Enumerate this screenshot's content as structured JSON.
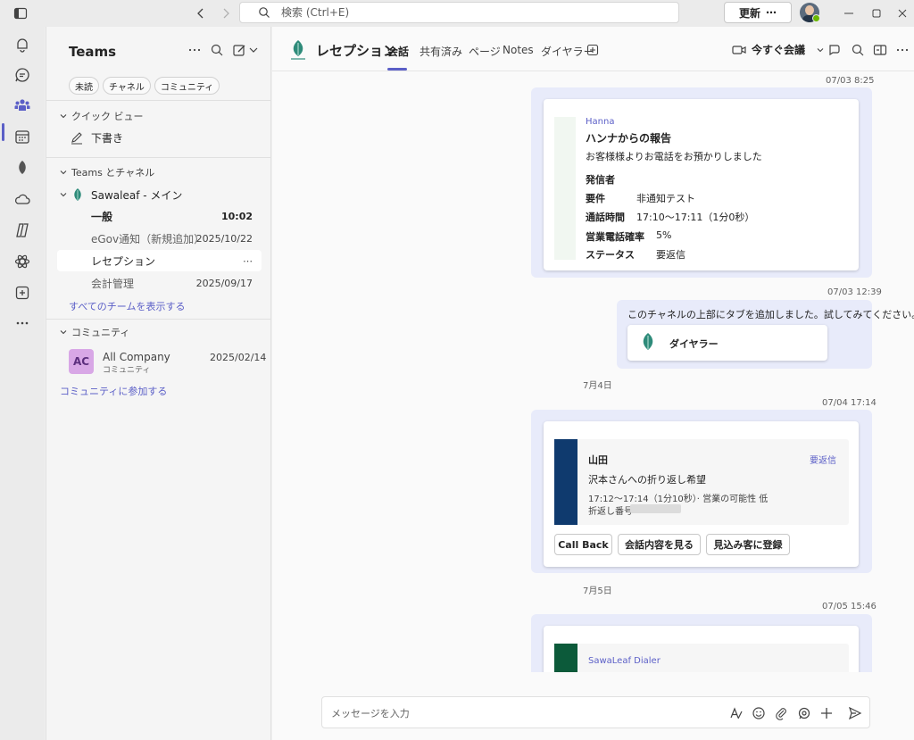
{
  "titlebar": {
    "search_placeholder": "検索 (Ctrl+E)",
    "update_label": "更新",
    "update_more": "⋯"
  },
  "pane": {
    "title": "Teams",
    "filters": [
      "未読",
      "チャネル",
      "コミュニティ"
    ],
    "quick_view": {
      "header": "クイック ビュー",
      "drafts": "下書き"
    },
    "teams_section": {
      "header": "Teams とチャネル"
    },
    "team": {
      "name": "Sawaleaf - メイン"
    },
    "channels": [
      {
        "name": "一般",
        "time": "10:02"
      },
      {
        "name": "eGov通知（新規追加）",
        "time": "2025/10/22"
      },
      {
        "name": "レセプション",
        "time": "⋯"
      },
      {
        "name": "会計管理",
        "time": "2025/09/17"
      }
    ],
    "show_all": "すべてのチームを表示する",
    "community_section": {
      "header": "コミュニティ"
    },
    "community": {
      "initials": "AC",
      "name": "All Company",
      "sub": "コミュニティ",
      "time": "2025/02/14"
    },
    "join_community": "コミュニティに参加する"
  },
  "header": {
    "channel_name": "レセプション",
    "tabs": [
      "会話",
      "共有済み",
      "ページ",
      "Notes",
      "ダイヤラー"
    ],
    "meet_now": "今すぐ会議"
  },
  "messages": {
    "m1": {
      "timestamp": "07/03 8:25",
      "sender": "Hanna",
      "title": "ハンナからの報告",
      "body": "お客様様よりお電話をお預かりしました",
      "caller_label": "発信者",
      "fields": [
        {
          "label": "要件",
          "value": "非通知テスト"
        },
        {
          "label": "通話時間",
          "value": "17:10〜17:11（1分0秒）"
        },
        {
          "label": "営業電話確率",
          "value": "5%"
        },
        {
          "label": "ステータス",
          "value": "要返信"
        }
      ]
    },
    "m2": {
      "timestamp": "07/03 12:39",
      "text": "このチャネルの上部にタブを追加しました。試してみてください。",
      "tab_name": "ダイヤラー"
    },
    "day1": "7月4日",
    "m3": {
      "timestamp": "07/04 17:14",
      "name": "山田",
      "status": "要返信",
      "subject": "沢本さんへの折り返し希望",
      "detail": "17:12〜17:14（1分10秒）· 営業の可能性 低",
      "callback_label": "折返し番号",
      "buttons": [
        "Call Back",
        "会話内容を見る",
        "見込み客に登録"
      ]
    },
    "day2": "7月5日",
    "m4": {
      "timestamp": "07/05 15:46",
      "sender": "SawaLeaf Dialer"
    }
  },
  "composer": {
    "placeholder": "メッセージを入力"
  },
  "colors": {
    "accent": "#5b5fc7",
    "bubble": "#e8ebfa",
    "card_bar_blue": "#0f3a6e",
    "card_bar_green": "#0c5a3a"
  }
}
